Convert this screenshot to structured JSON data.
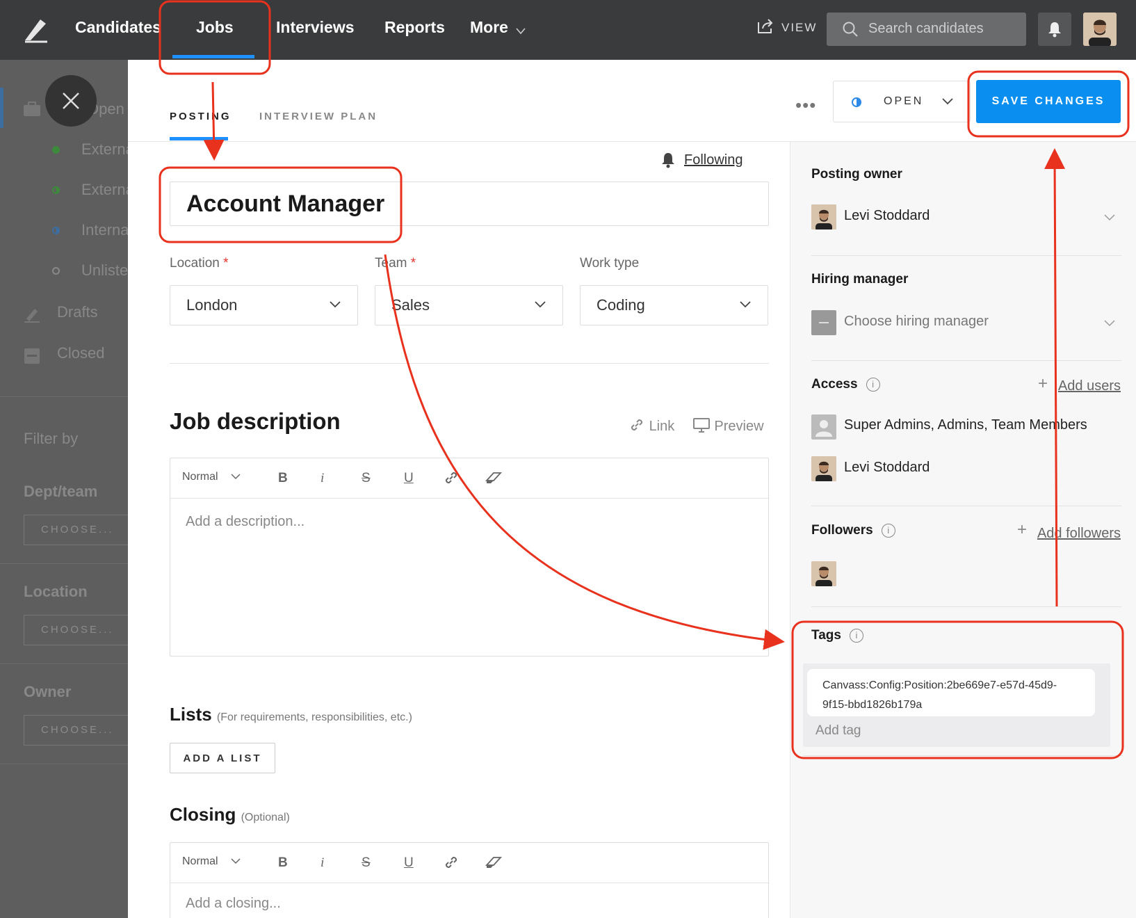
{
  "nav": {
    "items": [
      "Candidates",
      "Jobs",
      "Interviews",
      "Reports",
      "More"
    ],
    "view_label": "VIEW",
    "search_placeholder": "Search candidates"
  },
  "sidebar": {
    "open_jobs": "Open jobs",
    "external1": "External",
    "external2": "External",
    "internal": "Internal",
    "unlisted": "Unlisted",
    "drafts": "Drafts",
    "closed": "Closed",
    "filter_by": "Filter by",
    "dept_team": "Dept/team",
    "location": "Location",
    "owner": "Owner",
    "choose": "CHOOSE..."
  },
  "panel": {
    "tabs": [
      "POSTING",
      "INTERVIEW PLAN"
    ],
    "more": "•••",
    "status": "OPEN",
    "save_label": "SAVE CHANGES",
    "following": "Following",
    "job_title": "Account Manager",
    "location_label": "Location",
    "location_value": "London",
    "team_label": "Team",
    "team_value": "Sales",
    "work_type_label": "Work type",
    "work_type_value": "Coding",
    "required_mark": "*",
    "job_description": "Job description",
    "link_label": "Link",
    "preview_label": "Preview",
    "toolbar_normal": "Normal",
    "desc_placeholder": "Add a description...",
    "lists_title": "Lists",
    "lists_sub": "(For requirements, responsibilities, etc.)",
    "add_list": "ADD A LIST",
    "closing_title": "Closing",
    "closing_sub": "(Optional)",
    "closing_placeholder": "Add a closing..."
  },
  "right": {
    "posting_owner": "Posting owner",
    "owner_name": "Levi Stoddard",
    "hiring_manager": "Hiring manager",
    "hiring_placeholder": "Choose hiring manager",
    "access": "Access",
    "add_users": "Add users",
    "access_group": "Super Admins, Admins, Team Members",
    "access_user": "Levi Stoddard",
    "followers": "Followers",
    "add_followers": "Add followers",
    "tags": "Tags",
    "tag_value": "Canvass:Config:Position:2be669e7-e57d-45d9-9f15-bbd1826b179a",
    "add_tag": "Add tag"
  },
  "colors": {
    "accent": "#1e90ff",
    "annotation": "#e8321e",
    "nav_bg": "#3a3b3c"
  }
}
